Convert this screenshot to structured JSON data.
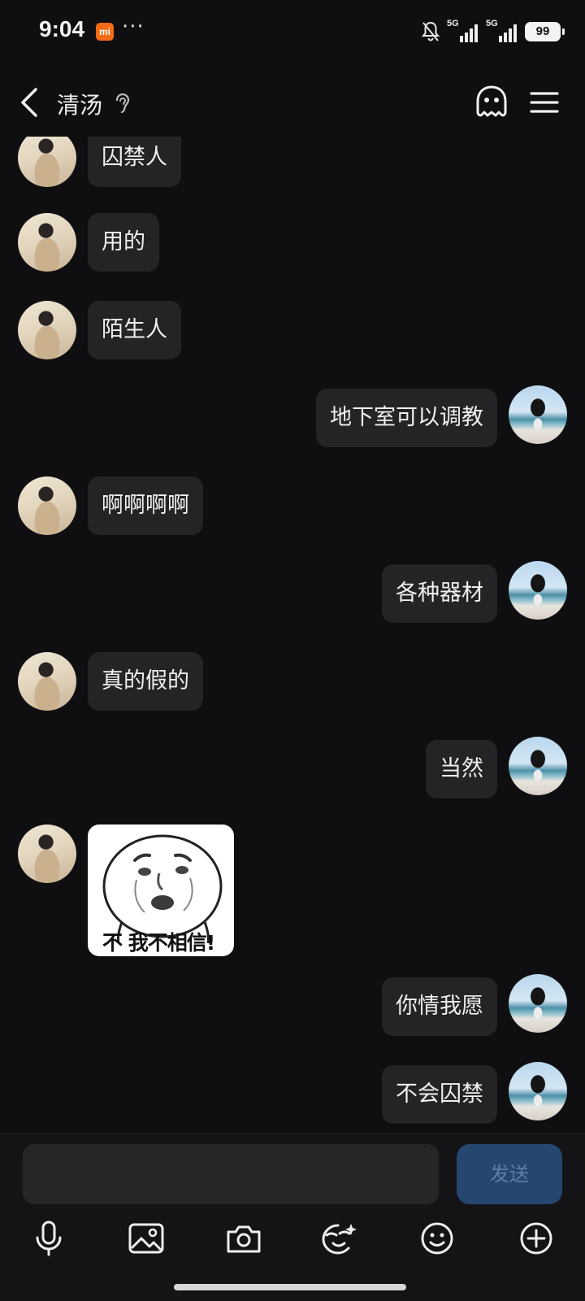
{
  "status_bar": {
    "time": "9:04",
    "mi_badge": "mi",
    "dots": "···",
    "signal1": "5G",
    "signal2": "5G",
    "battery": "99"
  },
  "header": {
    "title": "清汤",
    "back_icon": "chevron-left-icon",
    "ear_icon": "ear-icon",
    "ghost_icon": "ghost-icon",
    "menu_icon": "hamburger-menu-icon"
  },
  "messages": [
    {
      "side": "in",
      "text": "囚禁人"
    },
    {
      "side": "in",
      "text": "用的"
    },
    {
      "side": "in",
      "text": "陌生人"
    },
    {
      "side": "out",
      "text": "地下室可以调教"
    },
    {
      "side": "in",
      "text": "啊啊啊啊"
    },
    {
      "side": "out",
      "text": "各种器材"
    },
    {
      "side": "in",
      "text": "真的假的"
    },
    {
      "side": "out",
      "text": "当然"
    },
    {
      "side": "in",
      "type": "sticker",
      "caption": "不 我不相信!"
    },
    {
      "side": "out",
      "text": "你情我愿"
    },
    {
      "side": "out",
      "text": "不会囚禁"
    }
  ],
  "input": {
    "value": "",
    "placeholder": "",
    "send_label": "发送"
  },
  "toolbar": [
    {
      "name": "mic-icon"
    },
    {
      "name": "image-icon"
    },
    {
      "name": "camera-icon"
    },
    {
      "name": "sticker-face-icon"
    },
    {
      "name": "emoji-icon"
    },
    {
      "name": "plus-circle-icon"
    }
  ],
  "colors": {
    "background": "#0f0f11",
    "bubble": "#242427",
    "send_button": "#24466f",
    "mi_badge": "#f46a15"
  }
}
